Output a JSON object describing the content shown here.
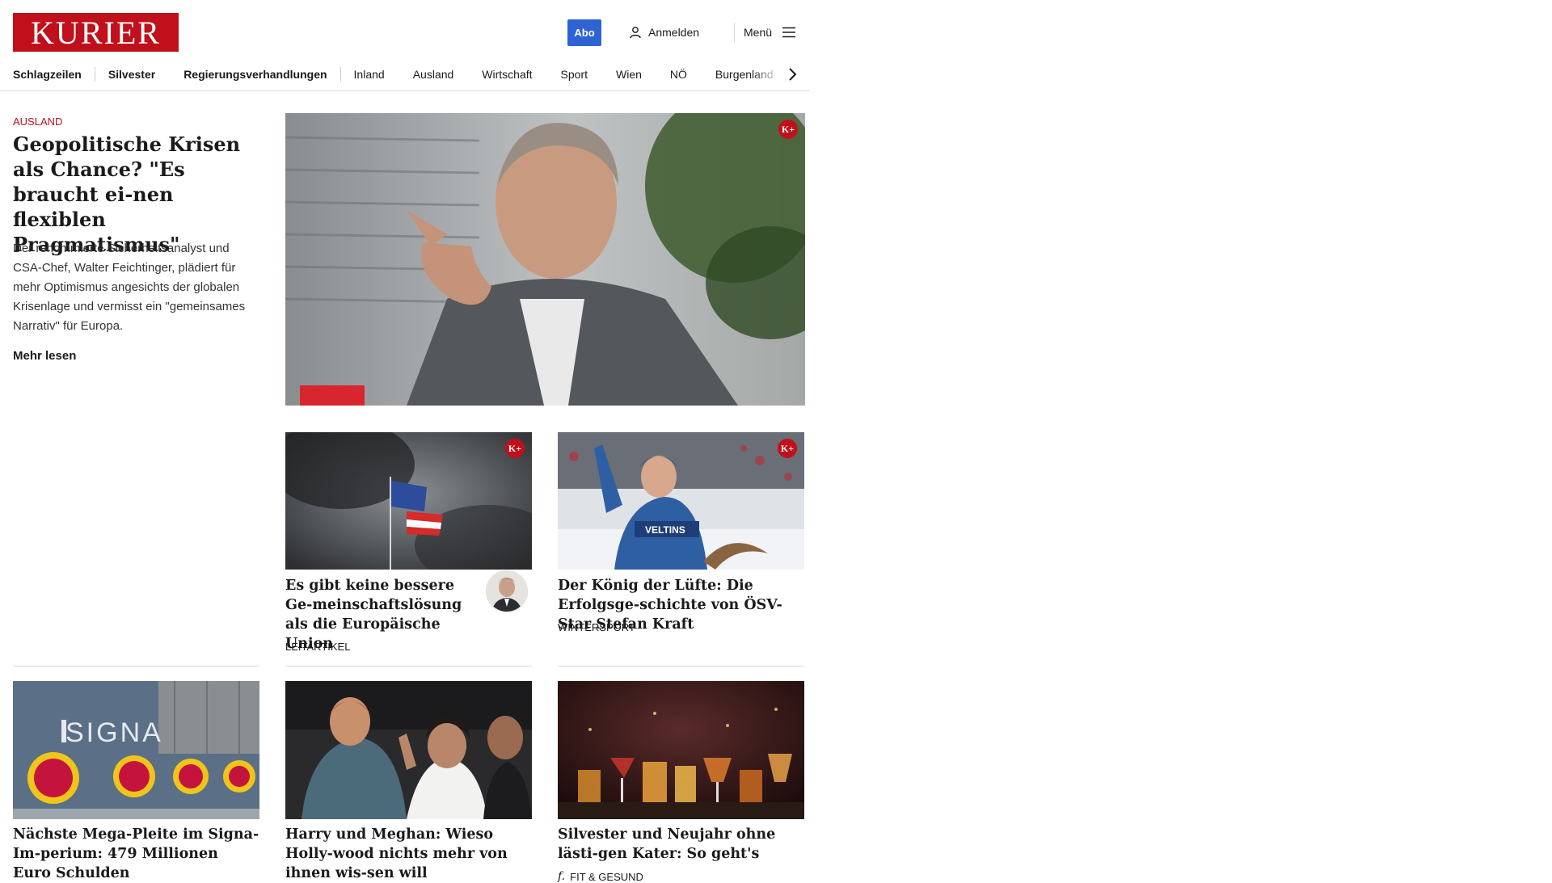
{
  "header": {
    "logo_text": "KURIER",
    "abo_label": "Abo",
    "login_label": "Anmelden",
    "menu_label": "Menü"
  },
  "nav": {
    "items": [
      "Schlagzeilen",
      "Silvester",
      "Regierungsverhandlungen",
      "Inland",
      "Ausland",
      "Wirtschaft",
      "Sport",
      "Wien",
      "NÖ",
      "Burgenland"
    ]
  },
  "lead": {
    "kicker": "AUSLAND",
    "title": "Geopolitische Krisen als Chance? \"Es braucht ei-nen flexiblen Pragmatismus\"",
    "text": "Der renommierte Sicherheitsanalyst und CSA-Chef, Walter Feichtinger, plädiert für mehr Optimismus angesichts der globalen Krisenlage und vermisst ein \"gemeinsames Narrativ\" für Europa.",
    "more_label": "Mehr lesen",
    "badge": "K+"
  },
  "cards": [
    {
      "title": "Es gibt keine bessere Ge-meinschaftslösung als die Europäische Union",
      "kicker": "LEITARTIKEL",
      "badge": "K+"
    },
    {
      "title": "Der König der Lüfte: Die Erfolgsge-schichte von ÖSV-Star Stefan Kraft",
      "kicker": "WINTERSPORT",
      "badge": "K+"
    },
    {
      "title": "Nächste Mega-Pleite im Signa-Im-perium: 479 Millionen Euro Schulden",
      "kicker": ""
    },
    {
      "title": "Harry und Meghan: Wieso Holly-wood nichts mehr von ihnen wis-sen will",
      "kicker": ""
    },
    {
      "title": "Silvester und Neujahr ohne lästi-gen Kater: So geht's",
      "kicker": "FIT & GESUND"
    }
  ],
  "image_texts": {
    "jersey": "VELTINS",
    "banner": "SIGNA"
  },
  "colors": {
    "brand": "#c0101b",
    "abo": "#2f63d3"
  },
  "icons": {
    "login": "user-icon",
    "menu": "hamburger-icon",
    "nav_more": "chevron-right-icon"
  }
}
